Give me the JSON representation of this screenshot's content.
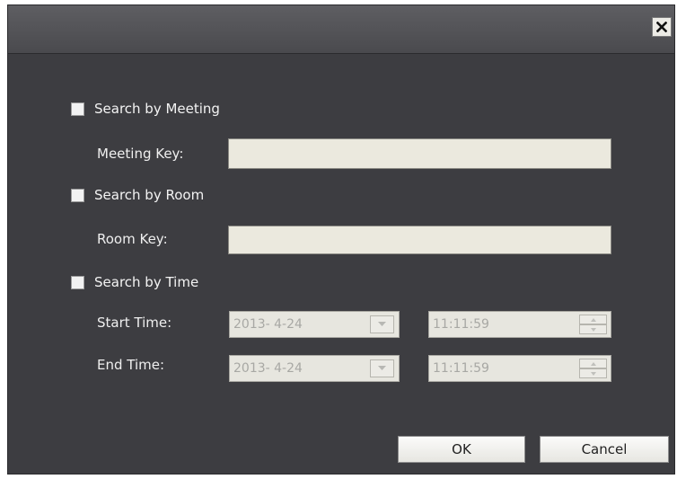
{
  "dialog": {
    "close_icon": "close-icon"
  },
  "search_meeting": {
    "checkbox_label": "Search by Meeting",
    "checked": false,
    "key_label": "Meeting Key:",
    "key_value": ""
  },
  "search_room": {
    "checkbox_label": "Search by Room",
    "checked": false,
    "key_label": "Room Key:",
    "key_value": ""
  },
  "search_time": {
    "checkbox_label": "Search by Time",
    "checked": false,
    "start_label": "Start Time:",
    "start_date": "2013- 4-24",
    "start_time": "11:11:59",
    "end_label": "End Time:",
    "end_date": "2013- 4-24",
    "end_time": "11:11:59"
  },
  "buttons": {
    "ok_label": "OK",
    "cancel_label": "Cancel"
  },
  "colors": {
    "dialog_bg": "#3d3d41",
    "input_bg": "#ebe9de",
    "disabled_text": "#a8a8a4"
  }
}
